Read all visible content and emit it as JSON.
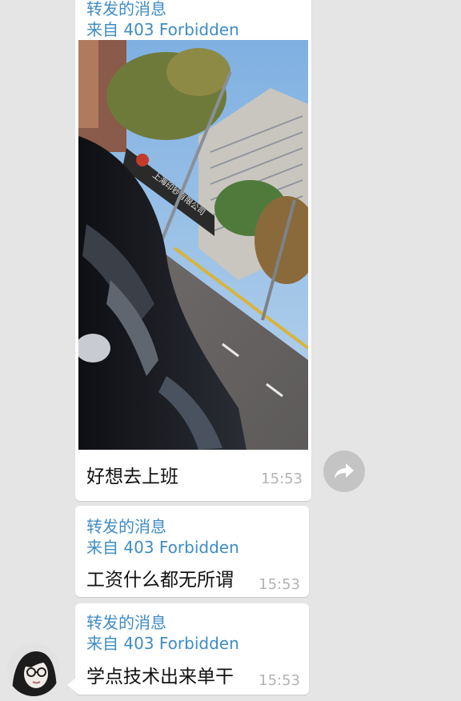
{
  "messages": [
    {
      "forward_label": "转发的消息",
      "source": "来自 403 Forbidden",
      "has_photo": true,
      "photo_sign_text": "上海印钞有限公司",
      "text": "好想去上班",
      "time": "15:53"
    },
    {
      "forward_label": "转发的消息",
      "source": "来自 403 Forbidden",
      "text": "工资什么都无所谓",
      "time": "15:53"
    },
    {
      "forward_label": "转发的消息",
      "source": "来自 403 Forbidden",
      "text": "学点技术出来单干",
      "time": "15:53"
    }
  ],
  "icons": {
    "share": "share-arrow-icon",
    "avatar": "user-avatar"
  },
  "colors": {
    "background": "#e5e5e5",
    "bubble": "#ffffff",
    "forward_text": "#3f8cc4",
    "message_text": "#111111",
    "timestamp": "#b3b3b3",
    "share_button": "#c4c4c4"
  }
}
